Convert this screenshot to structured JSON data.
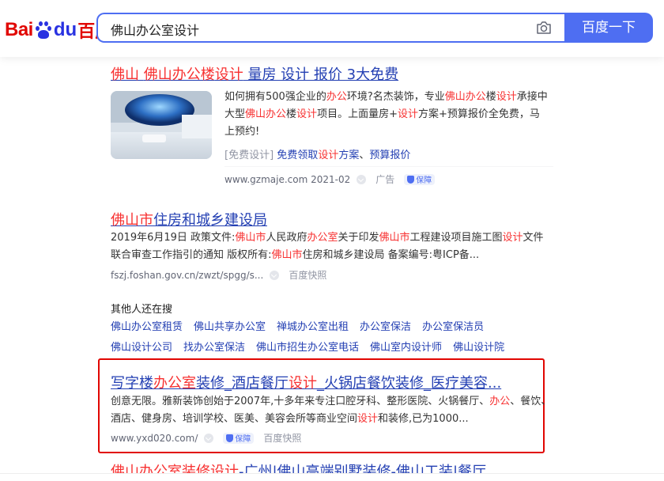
{
  "header": {
    "logo_bai": "Bai",
    "logo_du": "du",
    "logo_cn": "百度",
    "search_value": "佛山办公室设计",
    "search_button": "百度一下",
    "camera_icon": "camera-icon"
  },
  "results": [
    {
      "title_parts": [
        "佛山",
        " ",
        "佛山办公楼",
        "设计",
        " 量房 设计 报价 3大免费"
      ],
      "abstract_parts": [
        "如何拥有500强企业的",
        "办公",
        "环境?名杰装饰，专业",
        "佛山办公",
        "楼",
        "设计",
        "承接中大型",
        "佛山办公",
        "楼",
        "设计",
        "项目。上面量房+",
        "设计",
        "方案+预算报价全免费，马上预约!"
      ],
      "links_prefix": "[免费设计]",
      "link1_a": "免费领取",
      "link1_b": "设计",
      "link1_c": "方案",
      "link2": "预算报价",
      "url": "www.gzmaje.com",
      "date": "2021-02",
      "ad": "广告",
      "guarantee": "保障"
    },
    {
      "title_parts": [
        "佛山市",
        "住房和城乡建设局"
      ],
      "abstract_parts": [
        "2019年6月19日 政策文件:",
        "佛山市",
        "人民政府",
        "办公室",
        "关于印发",
        "佛山市",
        "工程建设项目施工图",
        "设计",
        "文件联合审查工作指引的通知 版权所有:",
        "佛山市",
        "住房和城乡建设局 备案编号:粤ICP备..."
      ],
      "url": "fszj.foshan.gov.cn/zwzt/spgg/s...",
      "snapshot": "百度快照"
    },
    {
      "title_parts": [
        "写字楼",
        "办公室",
        "装修_酒店餐厅",
        "设计",
        "_火锅店餐饮装修_医疗美容..."
      ],
      "abstract_parts": [
        "创意无限。雅新装饰创始于2007年,十多年来专注口腔牙科、整形医院、火锅餐厅、",
        "办公",
        "、餐饮、酒店、健身房、培训学校、医美、美容会所等商业空间",
        "设计",
        "和装修,已为1000..."
      ],
      "url": "www.yxd020.com/",
      "guarantee": "保障",
      "snapshot": "百度快照"
    },
    {
      "title_parts": [
        "佛山办公室",
        "装修",
        "设计",
        "-广州|佛山高端别墅装修-佛山工装|餐厅"
      ]
    }
  ],
  "others": {
    "title": "其他人还在搜",
    "row1": [
      "佛山办公室租赁",
      "佛山共享办公室",
      "禅城办公室出租",
      "办公室保洁",
      "办公室保洁员"
    ],
    "row2": [
      "佛山设计公司",
      "找办公室保洁",
      "佛山市招生办公室电话",
      "佛山室内设计师",
      "佛山设计院"
    ]
  },
  "colors": {
    "link": "#2440b3",
    "highlight": "#f73131",
    "brand_blue": "#4e6ef2",
    "brand_red": "#e10602"
  }
}
